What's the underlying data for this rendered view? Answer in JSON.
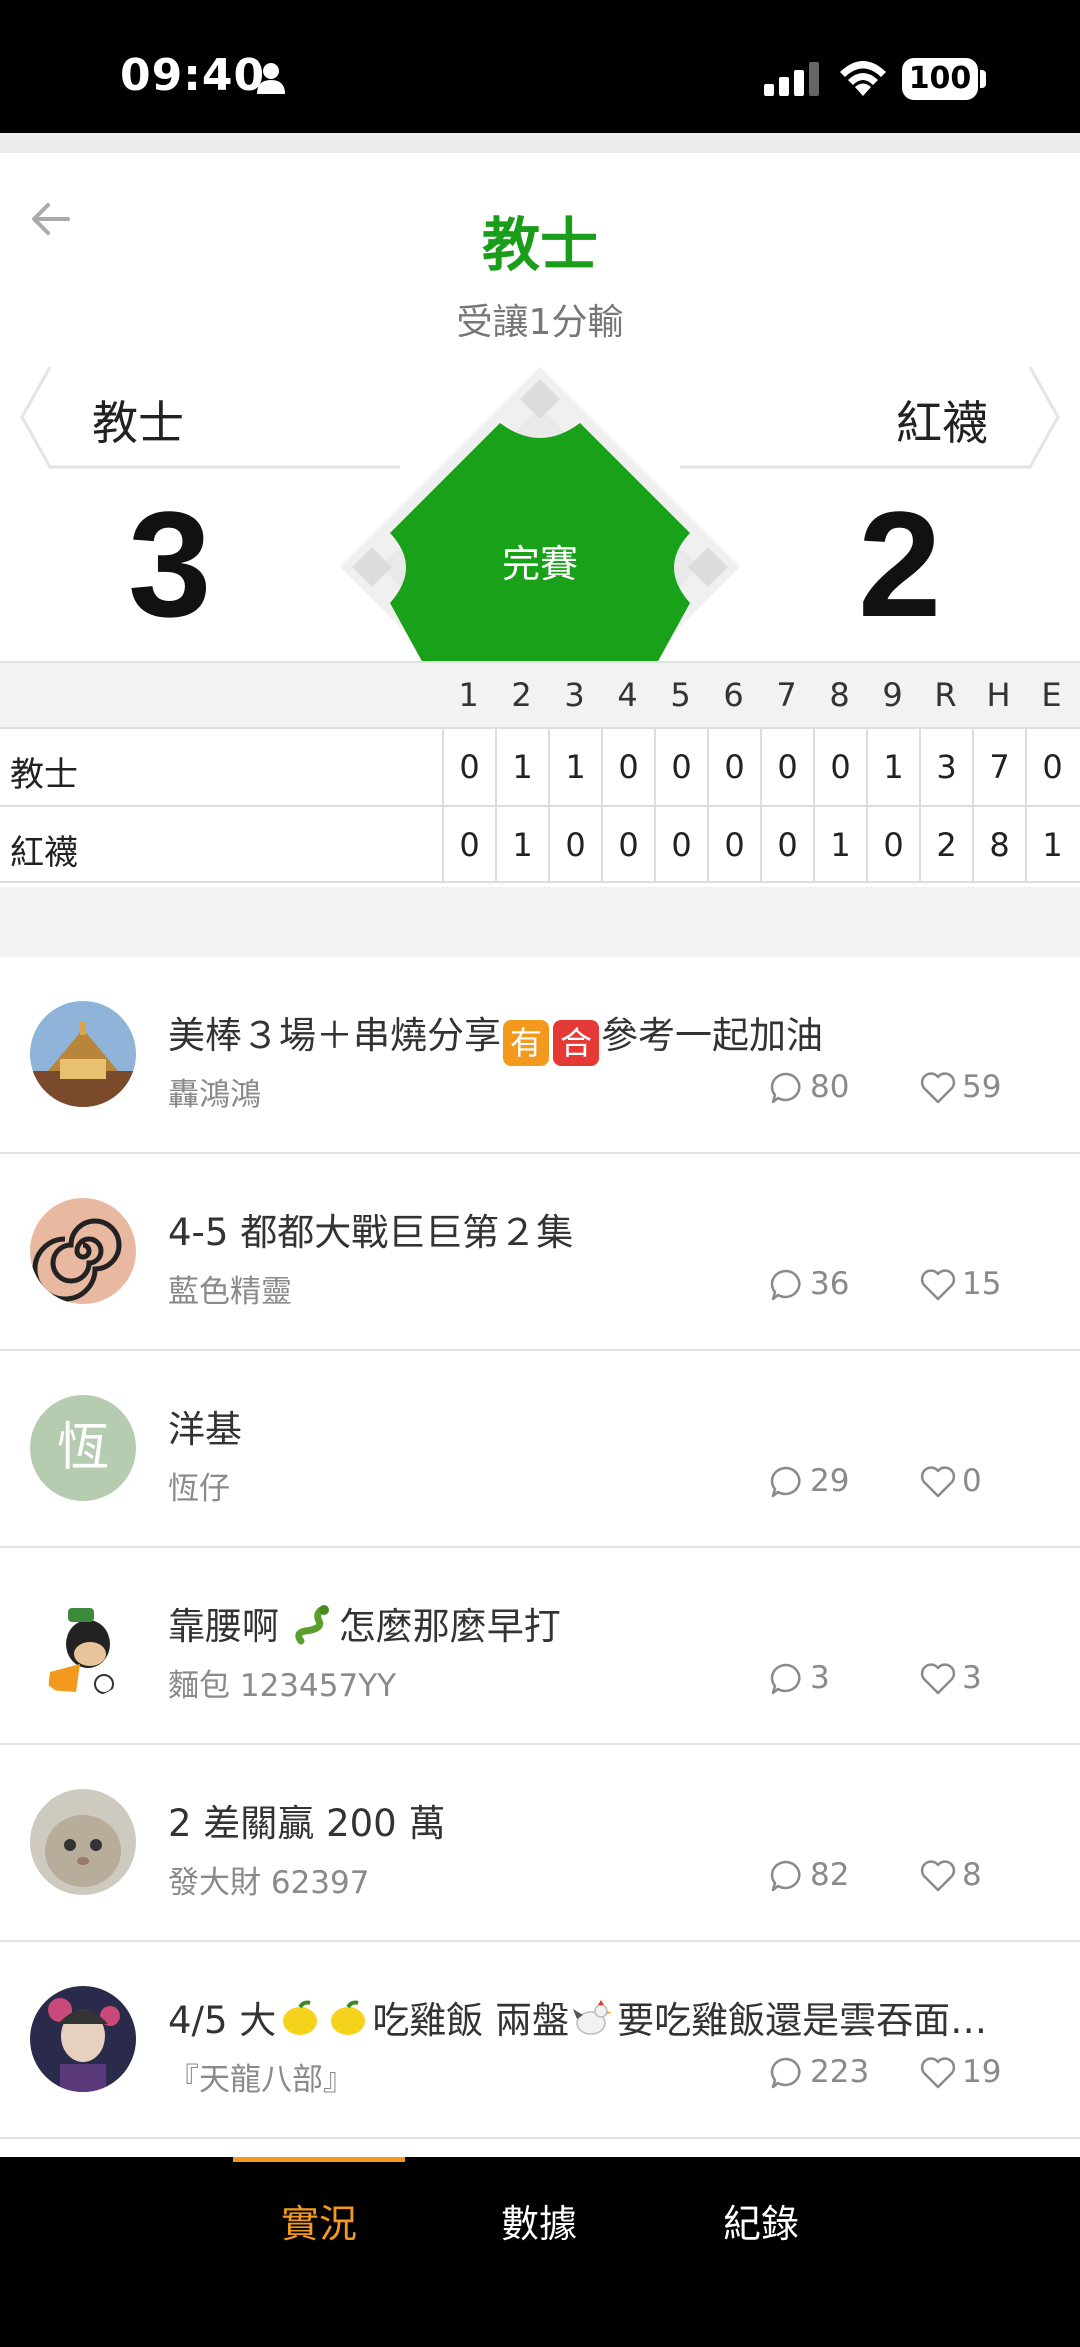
{
  "status_bar": {
    "time": "09:40",
    "battery": "100"
  },
  "header": {
    "winner": "教士",
    "result": "受讓1分輸"
  },
  "teams": {
    "away": {
      "name": "教士",
      "score": "3"
    },
    "home": {
      "name": "紅襪",
      "score": "2"
    }
  },
  "game_status": "完賽",
  "linescore": {
    "headers": [
      "1",
      "2",
      "3",
      "4",
      "5",
      "6",
      "7",
      "8",
      "9",
      "R",
      "H",
      "E"
    ],
    "rows": [
      {
        "team": "教士",
        "cells": [
          "0",
          "1",
          "1",
          "0",
          "0",
          "0",
          "0",
          "0",
          "1",
          "3",
          "7",
          "0"
        ]
      },
      {
        "team": "紅襪",
        "cells": [
          "0",
          "1",
          "0",
          "0",
          "0",
          "0",
          "0",
          "1",
          "0",
          "2",
          "8",
          "1"
        ]
      }
    ]
  },
  "posts": [
    {
      "title_a": "美棒３場＋串燒分享",
      "badge1": "有",
      "badge2": "合",
      "title_b": "參考一起加油",
      "author": "轟鴻鴻",
      "comments": "80",
      "likes": "59"
    },
    {
      "title": "4-5 都都大戰巨巨第２集",
      "author": "藍色精靈",
      "comments": "36",
      "likes": "15"
    },
    {
      "title": "洋基",
      "author": "恆仔",
      "avatar_letter": "恆",
      "comments": "29",
      "likes": "0"
    },
    {
      "title_a": "靠腰啊 ",
      "title_b": "怎麼那麼早打",
      "author": "麵包 123457YY",
      "comments": "3",
      "likes": "3"
    },
    {
      "title": "2 差關贏 200 萬",
      "author": "發大財 62397",
      "comments": "82",
      "likes": "8"
    },
    {
      "title_a": "4/5 大",
      "title_b": "吃雞飯 兩盤",
      "title_c": "要吃雞飯還是雲吞面…",
      "author": "『天龍八部』",
      "comments": "223",
      "likes": "19"
    }
  ],
  "tabs": [
    "實況",
    "數據",
    "紀錄"
  ],
  "colors": {
    "accent_green": "#1a9e1a",
    "tab_active": "#f39a1e"
  }
}
